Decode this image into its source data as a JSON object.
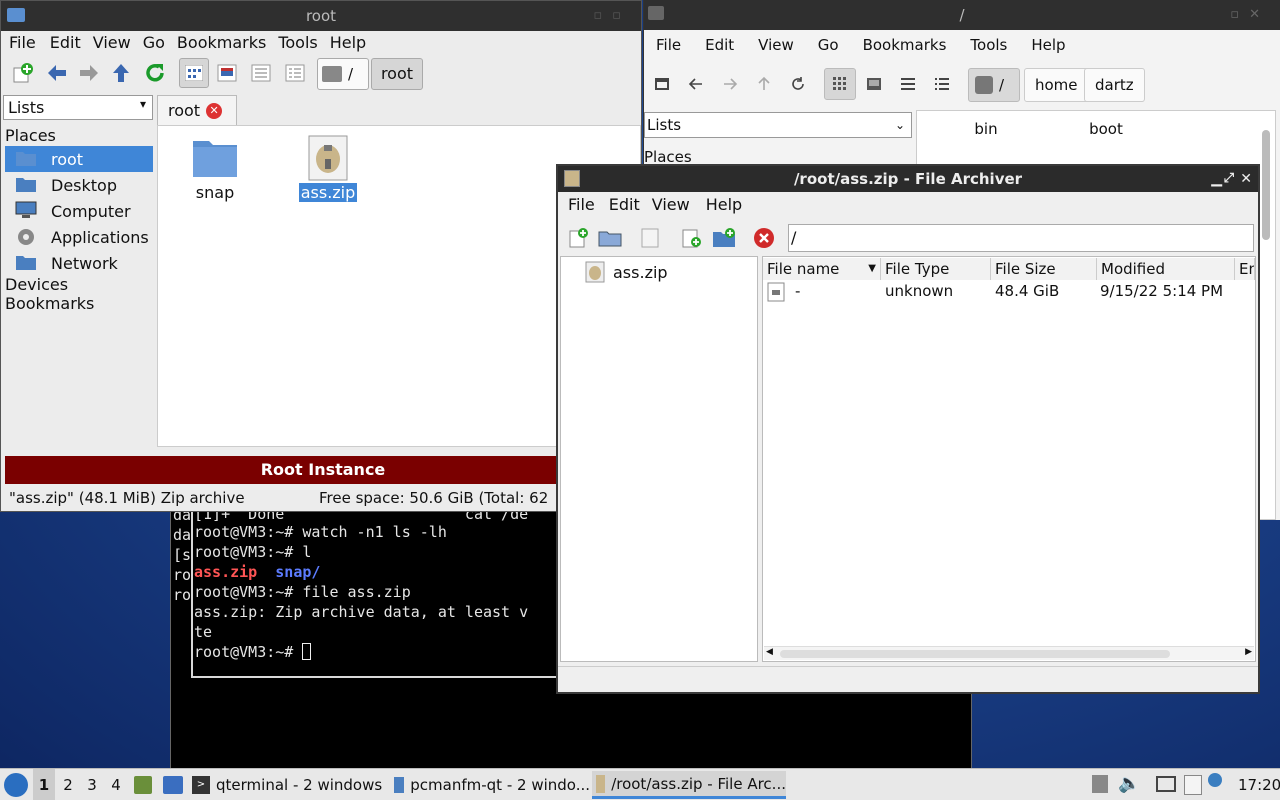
{
  "terminal": {
    "behind_lines": [
      "da",
      "da",
      "[s",
      "ro",
      "ro"
    ],
    "partial_top": "[1]+  Done                    cat /de",
    "lines": [
      {
        "prompt": "root@VM3:~# ",
        "cmd": "watch -n1 ls -lh"
      },
      {
        "prompt": "root@VM3:~# ",
        "cmd": "l"
      }
    ],
    "ls_zip": "ass.zip",
    "ls_snap": "snap/",
    "file_cmd_prompt": "root@VM3:~# ",
    "file_cmd": "file ass.zip",
    "file_output_1": "ass.zip: Zip archive data, at least v",
    "file_output_2": "te",
    "last_prompt": "root@VM3:~# "
  },
  "right_window": {
    "title": "/",
    "menu": [
      "File",
      "Edit",
      "View",
      "Go",
      "Bookmarks",
      "Tools",
      "Help"
    ],
    "path_root": "/",
    "crumbs": [
      "home",
      "dartz"
    ],
    "side_select": "Lists",
    "side_places": "Places",
    "files": [
      "bin",
      "boot"
    ]
  },
  "left_window": {
    "title": "root",
    "menu": [
      "File",
      "Edit",
      "View",
      "Go",
      "Bookmarks",
      "Tools",
      "Help"
    ],
    "path_root": "/",
    "crumb": "root",
    "side_select": "Lists",
    "places_header": "Places",
    "places": [
      "root",
      "Desktop",
      "Computer",
      "Applications",
      "Network"
    ],
    "devices": "Devices",
    "bookmarks": "Bookmarks",
    "tab_label": "root",
    "files": [
      {
        "name": "snap",
        "icon": "folder-icon"
      },
      {
        "name": "ass.zip",
        "icon": "zip-archive-icon"
      }
    ],
    "root_banner": "Root Instance",
    "status_left": "\"ass.zip\" (48.1 MiB) Zip archive",
    "status_right": "Free space: 50.6 GiB (Total: 62"
  },
  "archiver": {
    "title": "/root/ass.zip - File Archiver",
    "menu": [
      "File",
      "Edit",
      "View",
      "Help"
    ],
    "path": "/",
    "tree_item": "ass.zip",
    "columns": [
      "File name",
      "File Type",
      "File Size",
      "Modified",
      "Enc"
    ],
    "rows": [
      {
        "name": "-",
        "type": "unknown",
        "size": "48.4 GiB",
        "modified": "9/15/22 5:14 PM"
      }
    ]
  },
  "taskbar": {
    "desktops": [
      "1",
      "2",
      "3",
      "4"
    ],
    "tasks": [
      "qterminal - 2 windows",
      "pcmanfm-qt - 2 windo...",
      "/root/ass.zip - File Arc..."
    ],
    "clock": "17:20"
  },
  "colors": {
    "selection": "#3f86d7",
    "root_banner": "#7a0000",
    "accent_green": "#1a9a2a"
  }
}
